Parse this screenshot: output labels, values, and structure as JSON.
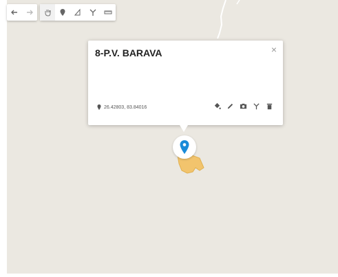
{
  "map": {
    "background_color": "#ebe8e1",
    "road_color": "#ffffff",
    "parcel_color": "#f2c46d"
  },
  "toolbar": {
    "undo_icon": "undo-icon",
    "redo_icon": "redo-icon",
    "pan_icon": "hand-icon",
    "marker_icon": "marker-icon",
    "line_icon": "draw-line-icon",
    "route_icon": "route-icon",
    "measure_icon": "ruler-icon"
  },
  "popup": {
    "title": "8-P.V. BARAVA",
    "close_label": "×",
    "coordinates": "26.42803, 83.84016",
    "actions": [
      "paint-bucket-icon",
      "edit-pencil-icon",
      "camera-icon",
      "route-icon",
      "trash-icon"
    ]
  },
  "marker": {
    "color": "#1a8bd8"
  }
}
